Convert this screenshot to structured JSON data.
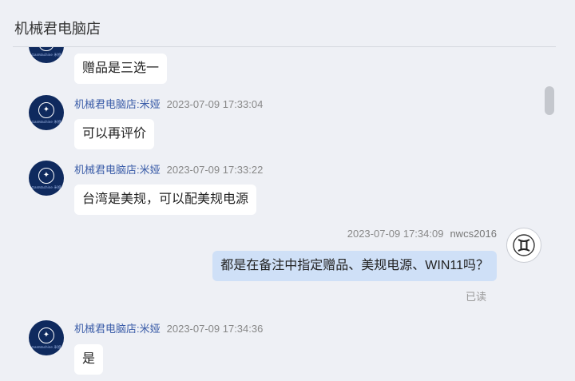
{
  "header": {
    "title": "机械君电脑店"
  },
  "shop_avatar": {
    "brand_text": "GanMachine 米娅"
  },
  "messages": [
    {
      "sender": "",
      "time": "",
      "text": "赠品是三选一"
    },
    {
      "sender": "机械君电脑店:米娅",
      "time": "2023-07-09 17:33:04",
      "text": "可以再评价"
    },
    {
      "sender": "机械君电脑店:米娅",
      "time": "2023-07-09 17:33:22",
      "text": "台湾是美规，可以配美规电源"
    },
    {
      "sender": "nwcs2016",
      "time": "2023-07-09 17:34:09",
      "text": "都是在备注中指定赠品、美规电源、WIN11吗？",
      "status": "已读"
    },
    {
      "sender": "机械君电脑店:米娅",
      "time": "2023-07-09 17:34:36",
      "text": "是"
    }
  ],
  "icons": {
    "shop_logo": "mech-logo-icon",
    "user_avatar": "gemini-zodiac-icon"
  }
}
